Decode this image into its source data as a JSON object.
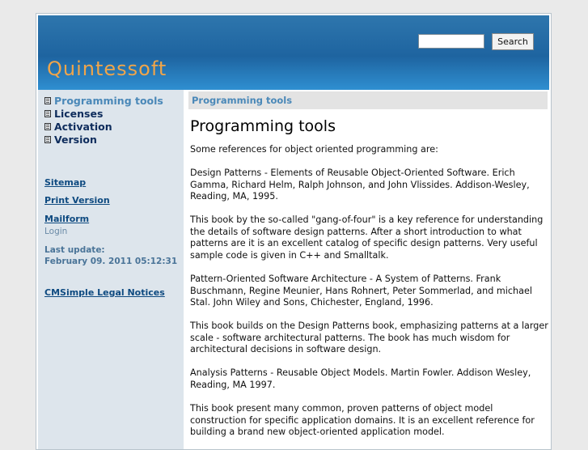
{
  "header": {
    "site_title": "Quintessoft",
    "search": {
      "value": "",
      "placeholder": "",
      "button_label": "Search"
    }
  },
  "sidebar": {
    "menu": [
      {
        "label": "Programming tools",
        "current": true
      },
      {
        "label": "Licenses",
        "current": false
      },
      {
        "label": "Activation",
        "current": false
      },
      {
        "label": "Version",
        "current": false
      }
    ],
    "links": {
      "sitemap": "Sitemap",
      "print_version": "Print Version",
      "mailform": "Mailform"
    },
    "login": "Login",
    "last_update_label": "Last update:",
    "last_update_value": "February 09. 2011 05:12:31",
    "legal": "CMSimple Legal Notices"
  },
  "main": {
    "breadcrumb": "Programming tools",
    "title": "Programming tools",
    "paragraphs": [
      "Some references for object oriented programming are:",
      "Design Patterns - Elements of Reusable Object-Oriented Software. Erich Gamma, Richard Helm, Ralph Johnson, and John Vlissides. Addison-Wesley, Reading, MA, 1995.",
      "This book by the so-called \"gang-of-four\" is a key reference for understanding the details of software design patterns. After a short introduction to what patterns are it is an excellent catalog of specific design patterns. Very useful sample code is given in C++ and Smalltalk.",
      "Pattern-Oriented Software Architecture - A System of Patterns. Frank Buschmann, Regine Meunier, Hans Rohnert, Peter Sommerlad, and michael Stal. John Wiley and Sons, Chichester, England, 1996.",
      "This book builds on the Design Patterns book, emphasizing patterns at a larger scale - software architectural patterns. The book has much wisdom for architectural decisions in software design.",
      "Analysis Patterns - Reusable Object Models. Martin Fowler. Addison Wesley, Reading, MA 1997.",
      "This book present many common, proven patterns of object model construction for specific application domains. It is an excellent reference for building a brand new object-oriented application model."
    ]
  },
  "colors": {
    "header_blue": "#1e64a0",
    "title_orange": "#f0a54a",
    "sidebar_bg": "#dde5ec",
    "current_menu": "#4a88b8",
    "menu_text": "#0e2c5c"
  }
}
